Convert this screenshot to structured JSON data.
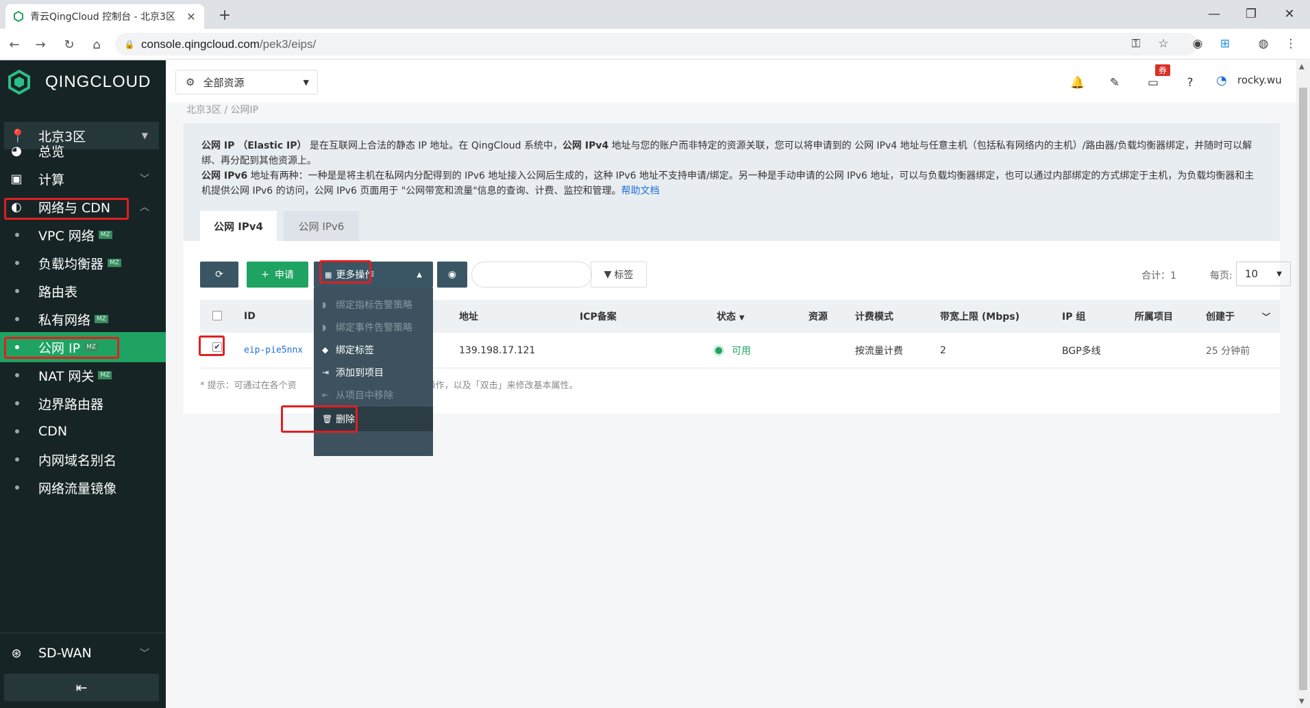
{
  "browser": {
    "tab_title": "青云QingCloud 控制台 - 北京3区",
    "url_host": "console.qingcloud.com",
    "url_path": "/pek3/eips/"
  },
  "sidebar": {
    "logo_text": "QINGCLOUD",
    "region": "北京3区",
    "items": [
      {
        "label": "总览",
        "icon": "dashboard-icon"
      },
      {
        "label": "计算",
        "icon": "compute-icon"
      },
      {
        "label": "网络与 CDN",
        "icon": "network-icon"
      }
    ],
    "network_sub": [
      {
        "label": "VPC 网络",
        "badge": "MZ"
      },
      {
        "label": "负载均衡器",
        "badge": "MZ"
      },
      {
        "label": "路由表",
        "badge": ""
      },
      {
        "label": "私有网络",
        "badge": "MZ"
      },
      {
        "label": "公网 IP",
        "badge": "MZ"
      },
      {
        "label": "NAT 网关",
        "badge": "MZ"
      },
      {
        "label": "边界路由器",
        "badge": ""
      },
      {
        "label": "CDN",
        "badge": ""
      },
      {
        "label": "内网域名别名",
        "badge": ""
      },
      {
        "label": "网络流量镜像",
        "badge": ""
      }
    ],
    "sdwan": "SD-WAN"
  },
  "header": {
    "resource_select": "全部资源",
    "coupon_badge": "券",
    "username": "rocky.wu"
  },
  "breadcrumb": "北京3区  /  公网IP",
  "intro": {
    "l1_b1": "公网 IP （Elastic IP）",
    "l1_t1": " 是在互联网上合法的静态 IP 地址。在 QingCloud 系统中，",
    "l1_b2": "公网 IPv4",
    "l1_t2": " 地址与您的账户而非特定的资源关联，您可以将申请到的 公网 IPv4 地址与任意主机（包括私有网络内的主机）/路由器/负载均衡器绑定，并随时可以解绑、再分配到其他资源上。",
    "l2_b": "公网 IPv6",
    "l2_t": " 地址有两种：一种是是将主机在私网内分配得到的 IPv6 地址接入公网后生成的，这种 IPv6 地址不支持申请/绑定。另一种是手动申请的公网 IPv6 地址，可以与负载均衡器绑定，也可以通过内部绑定的方式绑定于主机，为负载均衡器和主机提供公网 IPv6 的访问，公网 IPv6 页面用于 \"公网带宽和流量\"信息的查询、计费、监控和管理。",
    "link": "帮助文档"
  },
  "tabs": [
    "公网 IPv4",
    "公网 IPv6"
  ],
  "toolbar": {
    "apply": "申请",
    "more": "更多操作",
    "tag": "标签",
    "total": "合计：1",
    "per_page_label": "每页:",
    "page_size": "10"
  },
  "table": {
    "headers": [
      "ID",
      "地址",
      "ICP备案",
      "状态",
      "资源",
      "计费模式",
      "带宽上限 (Mbps)",
      "IP 组",
      "所属项目",
      "创建于"
    ],
    "row": {
      "id": "eip-pie5nnx",
      "address": "139.198.17.121",
      "icp": "",
      "status": "可用",
      "resource": "",
      "billing": "按流量计费",
      "bandwidth": "2",
      "ip_group": "BGP多线",
      "project": "",
      "created": "25 分钟前"
    }
  },
  "hint": {
    "left": "* 提示：可通过在各个资",
    "right": "常用操作，以及「双击」来修改基本属性。"
  },
  "dropdown": [
    {
      "label": "绑定指标告警策略",
      "enabled": false,
      "icon": "bell-icon"
    },
    {
      "label": "绑定事件告警策略",
      "enabled": false,
      "icon": "bell-icon"
    },
    {
      "label": "绑定标签",
      "enabled": true,
      "icon": "tag-icon"
    },
    {
      "label": "添加到项目",
      "enabled": true,
      "icon": "login-icon"
    },
    {
      "label": "从项目中移除",
      "enabled": false,
      "icon": "logout-icon"
    },
    {
      "label": "删除",
      "enabled": true,
      "icon": "trash-icon"
    }
  ],
  "colors": {
    "brand_green": "#1fa362",
    "sidebar_bg": "#172426",
    "highlight_red": "#e02020",
    "toolbar_btn": "#3a5564"
  }
}
